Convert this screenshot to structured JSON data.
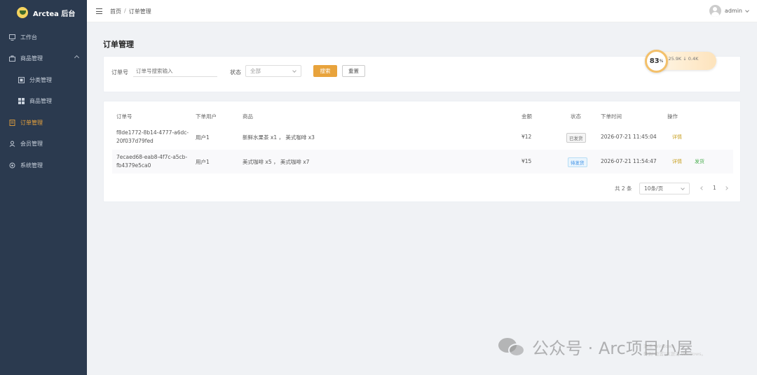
{
  "app": {
    "title": "Arctea 后台"
  },
  "sidebar": {
    "items": [
      {
        "label": "工作台",
        "icon": "monitor-icon"
      },
      {
        "label": "商品管理",
        "icon": "bag-icon"
      },
      {
        "label": "分类管理",
        "icon": "square-icon"
      },
      {
        "label": "商品管理",
        "icon": "grid-icon"
      },
      {
        "label": "订单管理",
        "icon": "document-icon"
      },
      {
        "label": "会员管理",
        "icon": "user-icon"
      },
      {
        "label": "系统管理",
        "icon": "gear-icon"
      }
    ]
  },
  "header": {
    "breadcrumb": [
      "首页",
      "订单管理"
    ],
    "user": "admin"
  },
  "page": {
    "title": "订单管理"
  },
  "filter": {
    "order_label": "订单号",
    "order_placeholder": "订单号搜索输入",
    "status_label": "状态",
    "status_value": "全部",
    "search_label": "搜索",
    "reset_label": "重置"
  },
  "badge": {
    "percent": "83",
    "unit": "%",
    "stats": "↑25.9K  ↓ 0.4K"
  },
  "table": {
    "headers": [
      "订单号",
      "下单用户",
      "商品",
      "金额",
      "状态",
      "下单时间",
      "操作"
    ],
    "rows": [
      {
        "id_line1": "f8de1772-8b14-4777-a6dc-",
        "id_line2": "20f037d79fed",
        "user": "用户1",
        "items": "新鲜水果茶 x1 ， 美式咖啡 x3",
        "amount": "¥12",
        "status": "已发货",
        "time": "2026-07-21 11:45:04",
        "actions": [
          "详情"
        ]
      },
      {
        "id_line1": "7ecaed68-eab8-4f7c-a5cb-",
        "id_line2": "fb4379e5ca0",
        "user": "用户1",
        "items": "美式咖啡 x5 ， 美式咖啡 x7",
        "amount": "¥15",
        "status": "待发货",
        "time": "2026-07-21 11:54:47",
        "actions": [
          "详情",
          "发货"
        ]
      }
    ]
  },
  "pagination": {
    "total": "共 2 条",
    "page_size": "10条/页",
    "current": "1"
  },
  "watermark": {
    "text": "公众号 · Arc项目小屋",
    "line1": "激活 Windows",
    "line2": "转到\"设置\"以激活 Windows。"
  },
  "colors": {
    "accent": "#e8a33c",
    "sidebar": "#2b3a4f",
    "paid": "#3a8ee6",
    "confirm": "#4caf50"
  }
}
